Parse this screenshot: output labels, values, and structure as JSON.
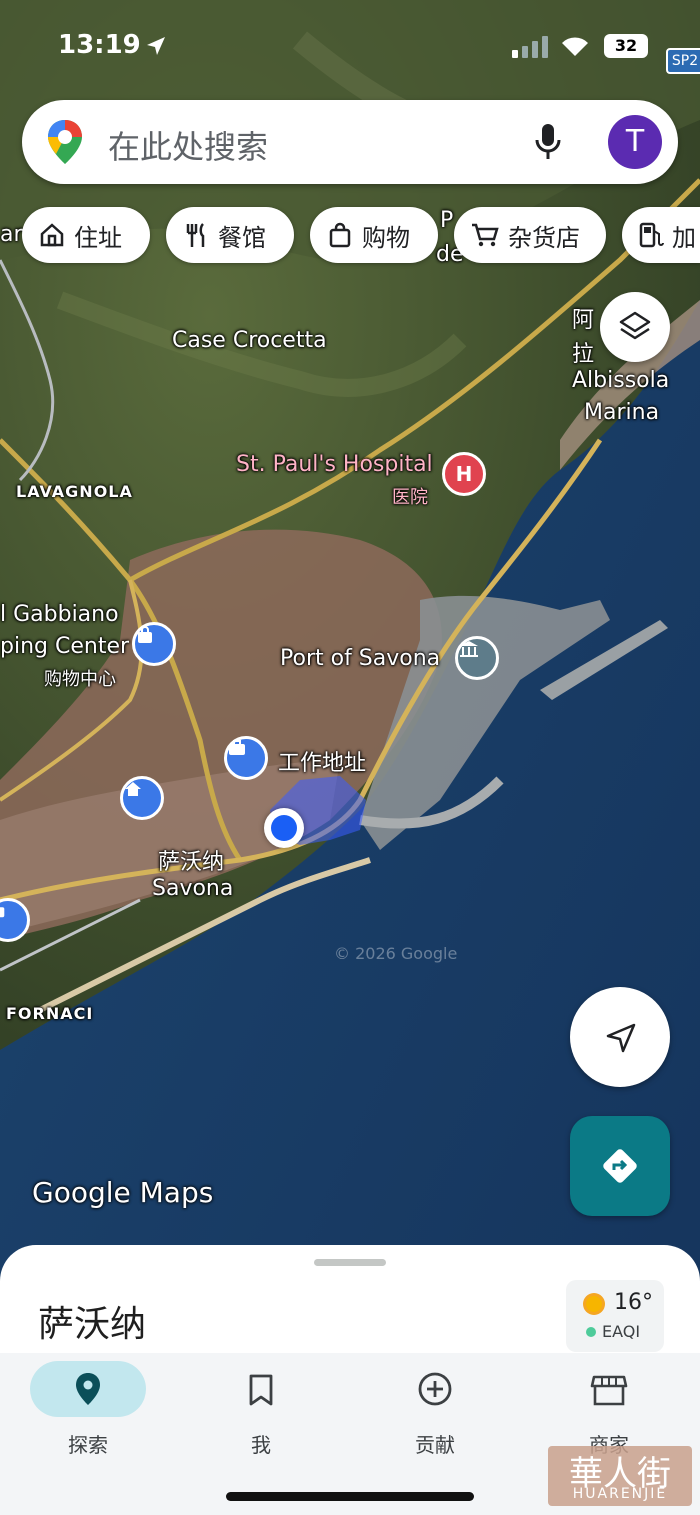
{
  "status_bar": {
    "time": "13:19",
    "battery": "32"
  },
  "search": {
    "placeholder": "在此处搜索",
    "avatar_letter": "T"
  },
  "chips": [
    {
      "label": "住址",
      "icon": "home-icon"
    },
    {
      "label": "餐馆",
      "icon": "restaurant-icon"
    },
    {
      "label": "购物",
      "icon": "shopping-bag-icon"
    },
    {
      "label": "杂货店",
      "icon": "cart-icon"
    },
    {
      "label": "加",
      "icon": "gas-station-icon"
    }
  ],
  "map": {
    "labels": {
      "road_sign": "SP2",
      "case_crocetta": "Case Crocetta",
      "albissola_cn1": "阿",
      "albissola_cn2": "拉",
      "albissola_1": "Albissola",
      "albissola_2": "Marina",
      "hospital_name": "St. Paul's Hospital",
      "hospital_type": "医院",
      "lavagnola": "LAVAGNOLA",
      "gabbiano_1": "l Gabbiano",
      "gabbiano_2": "ping Center",
      "gabbiano_type": "购物中心",
      "port": "Port of Savona",
      "work": "工作地址",
      "city_cn": "萨沃纳",
      "city_en": "Savona",
      "fornaci": "FORNACI",
      "copyright": "© 2026 Google",
      "watermark": "Google Maps",
      "left_fragment": "ar",
      "pde_fragment_1": "P",
      "pde_fragment_2": "de"
    }
  },
  "sheet": {
    "title": "萨沃纳",
    "temperature": "16°",
    "aqi_label": "EAQI"
  },
  "nav": [
    {
      "label": "探索",
      "icon": "explore-pin-icon",
      "active": true
    },
    {
      "label": "我",
      "icon": "bookmark-icon",
      "active": false
    },
    {
      "label": "贡献",
      "icon": "add-circle-icon",
      "active": false
    },
    {
      "label": "商家",
      "icon": "store-icon",
      "active": false
    }
  ],
  "colors": {
    "accent_teal": "#0b7a86",
    "nav_active": "#c2e7ee",
    "avatar": "#5b2bb1",
    "hospital": "#e0434f",
    "pin_blue": "#3b78e7"
  },
  "overlay": {
    "watermark_site": "HUARENJIE",
    "watermark_cn": "華人街"
  }
}
